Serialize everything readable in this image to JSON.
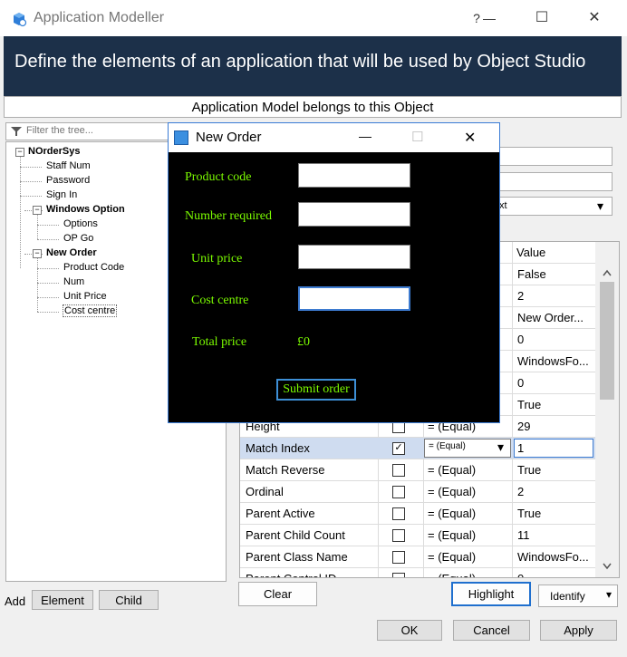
{
  "window": {
    "title": "Application Modeller",
    "help_glyph": "?",
    "minimize_glyph": "—",
    "maximize_glyph": "☐",
    "close_glyph": "✕"
  },
  "banner": {
    "text": "Define the elements of an application that will be used by Object Studio"
  },
  "object_row": {
    "text": "Application Model belongs to this Object"
  },
  "filter": {
    "placeholder": "Filter the tree..."
  },
  "tree": {
    "root": "NOrderSys",
    "items": [
      {
        "label": "Staff Num"
      },
      {
        "label": "Password"
      },
      {
        "label": "Sign In"
      },
      {
        "label": "Windows Option"
      },
      {
        "label": "Options"
      },
      {
        "label": "OP Go"
      },
      {
        "label": "New Order"
      },
      {
        "label": "Product Code"
      },
      {
        "label": "Num"
      },
      {
        "label": "Unit Price"
      },
      {
        "label": "Cost centre"
      }
    ],
    "expander_glyph": "−"
  },
  "add_row": {
    "label": "Add",
    "element_button": "Element",
    "child_button": "Child"
  },
  "right_panel": {
    "type_field_value": "xt",
    "dropdown_arrow": "▾"
  },
  "attributes": {
    "value_header": "Value",
    "match_selected": "=  (Equal)",
    "rows": [
      {
        "name": "",
        "checked": false,
        "match": "",
        "value": "False"
      },
      {
        "name": "",
        "checked": false,
        "match": "",
        "value": "2"
      },
      {
        "name": "",
        "checked": false,
        "match": "",
        "value": "New Order..."
      },
      {
        "name": "",
        "checked": false,
        "match": "",
        "value": "0"
      },
      {
        "name": "",
        "checked": false,
        "match": "",
        "value": "WindowsFo..."
      },
      {
        "name": "",
        "checked": false,
        "match": "",
        "value": "0"
      },
      {
        "name": "",
        "checked": false,
        "match": "",
        "value": "True"
      },
      {
        "name": "Height",
        "checked": false,
        "match": "=  (Equal)",
        "value": "29"
      },
      {
        "name": "Match Index",
        "checked": true,
        "match": "=  (Equal)",
        "value": "1"
      },
      {
        "name": "Match Reverse",
        "checked": false,
        "match": "=  (Equal)",
        "value": "True"
      },
      {
        "name": "Ordinal",
        "checked": false,
        "match": "=  (Equal)",
        "value": "2"
      },
      {
        "name": "Parent Active",
        "checked": false,
        "match": "=  (Equal)",
        "value": "True"
      },
      {
        "name": "Parent Child Count",
        "checked": false,
        "match": "=  (Equal)",
        "value": "11"
      },
      {
        "name": "Parent Class Name",
        "checked": false,
        "match": "=  (Equal)",
        "value": "WindowsFo..."
      },
      {
        "name": "Parent Control ID",
        "checked": false,
        "match": "=  (Equal)",
        "value": "0"
      }
    ]
  },
  "actions": {
    "clear": "Clear",
    "highlight": "Highlight",
    "identify": "Identify",
    "identify_arrow": "▾"
  },
  "footer": {
    "ok": "OK",
    "cancel": "Cancel",
    "apply": "Apply"
  },
  "dialog": {
    "title": "New Order",
    "minimize_glyph": "—",
    "maximize_glyph": "☐",
    "close_glyph": "✕",
    "labels": {
      "product_code": "Product code",
      "number_required": "Number required",
      "unit_price": "Unit price",
      "cost_centre": "Cost centre",
      "total_price": "Total price"
    },
    "inputs": {
      "product_code": "",
      "number_required": "",
      "unit_price": "",
      "cost_centre": ""
    },
    "total_value": "£0",
    "submit": "Submit order"
  }
}
